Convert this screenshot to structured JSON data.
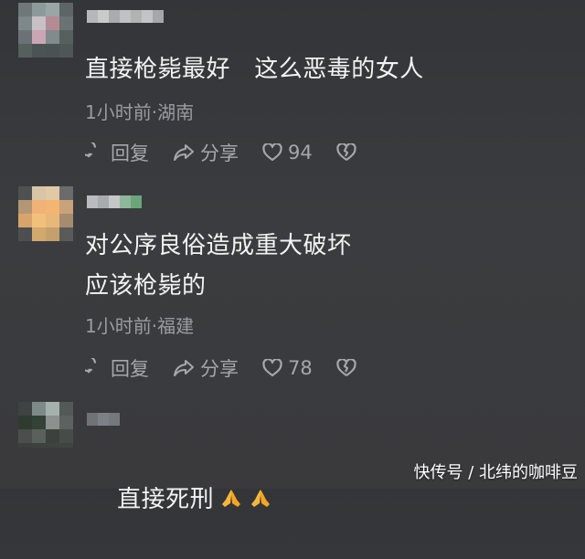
{
  "comments": [
    {
      "text": "直接枪毙最好   这么恶毒的女人",
      "meta": "1小时前·湖南",
      "reply_label": "回复",
      "share_label": "分享",
      "likes": "94",
      "avatar_colors": [
        "#6f7778",
        "#8d9a9b",
        "#9aa5a7",
        "#5d6566",
        "#7e8889",
        "#c7c0c4",
        "#b58b93",
        "#6b7274",
        "#6a7275",
        "#caa6b4",
        "#7f8b8d",
        "#58605f",
        "#55605e",
        "#4b5454",
        "#4a5351",
        "#4f5756"
      ],
      "name_colors": [
        "#b5b8bb",
        "#c8cacc",
        "#a9acaf",
        "#bfc1c3",
        "#b0b2b4",
        "#c2c4c6",
        "#a5a8aa"
      ]
    },
    {
      "text_lines": [
        "对公序良俗造成重大破坏",
        "应该枪毙的"
      ],
      "meta": "1小时前·福建",
      "reply_label": "回复",
      "share_label": "分享",
      "likes": "78",
      "avatar_colors": [
        "#4e5152",
        "#d8c4a6",
        "#e0c9a5",
        "#6a6b6a",
        "#b39774",
        "#f0b276",
        "#f3b571",
        "#c9a27a",
        "#d8a46c",
        "#f1c07d",
        "#e8b879",
        "#a58b6f",
        "#4c4e4f",
        "#d2a96d",
        "#c4a06c",
        "#5a5a58"
      ],
      "name_colors": [
        "#b9bcbe",
        "#a8abae",
        "#c4c6c8",
        "#8fb79a",
        "#6aa57b"
      ]
    },
    {
      "text": "直接死刑",
      "avatar_colors": [
        "#3f4342",
        "#7d8a85",
        "#a5b1ac",
        "#545956",
        "#2f3a30",
        "#334236",
        "#8b918e",
        "#5c625f",
        "#4a4f4c",
        "#5a605c",
        "#3c413e",
        "#474c49",
        "#3b3f3d",
        "#3d423f",
        "#3e4340",
        "#3f4441"
      ],
      "name_colors": [
        "#6f7377",
        "#7d8185",
        "#75797d"
      ]
    }
  ],
  "watermark": "快传号 / 北纬的咖啡豆",
  "icons": [
    "comment-bubble-icon",
    "share-arrow-icon",
    "heart-icon",
    "broken-heart-icon",
    "praying-hands-emoji"
  ]
}
